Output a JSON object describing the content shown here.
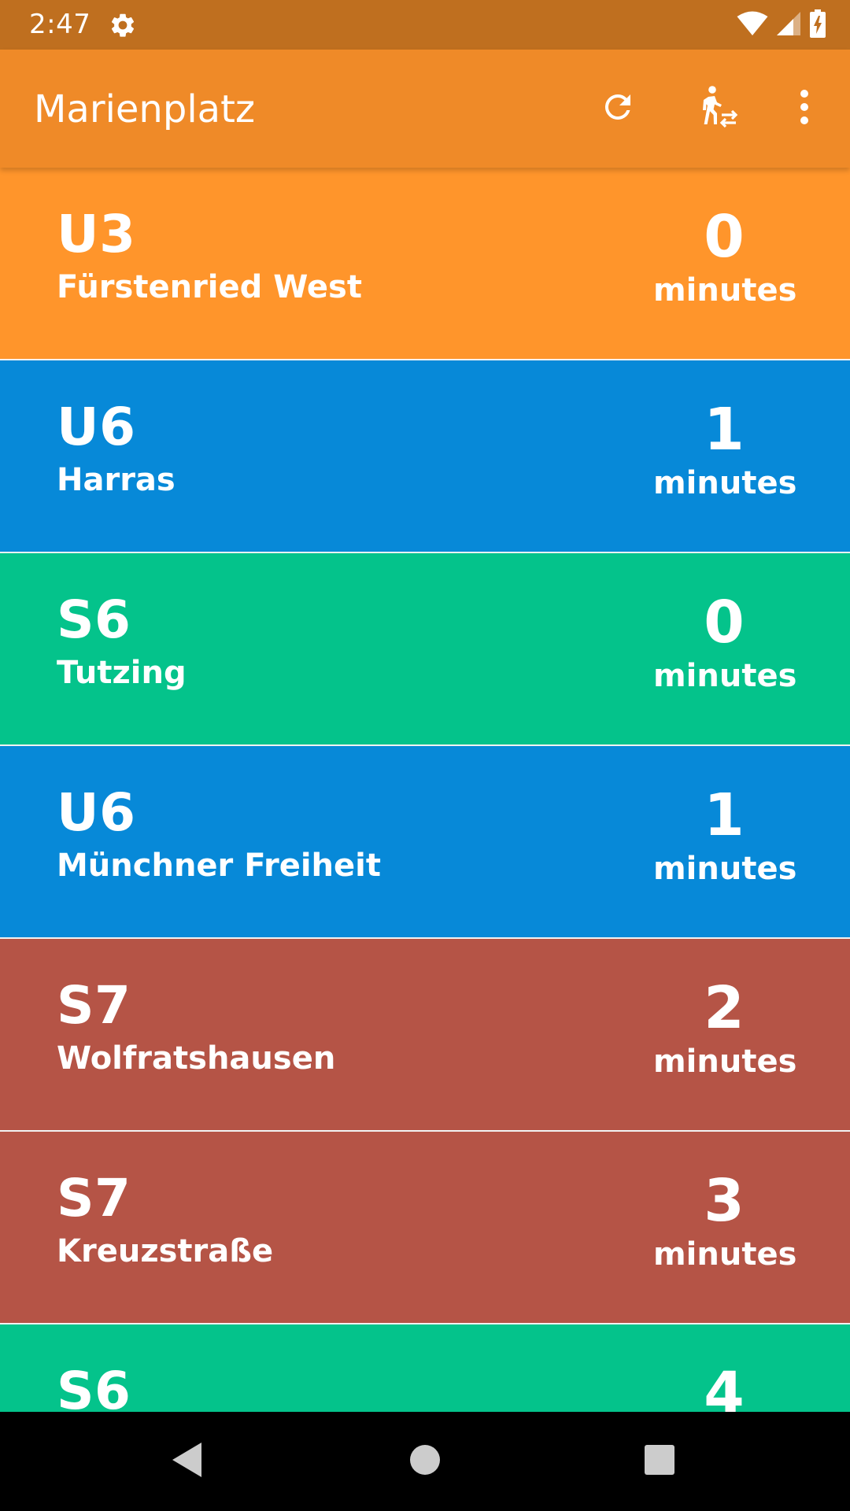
{
  "status_bar": {
    "time": "2:47",
    "icons": [
      "gear-icon",
      "wifi-icon",
      "signal-icon",
      "battery-charging-icon"
    ]
  },
  "app_bar": {
    "title": "Marienplatz",
    "actions": [
      "refresh-icon",
      "walk-transfer-icon",
      "more-vert-icon"
    ]
  },
  "colors": {
    "status_bar": "#BF6F1F",
    "app_bar": "#EF8A28",
    "U3": "#FF952B",
    "U6": "#0789D8",
    "S6": "#04C38B",
    "S7": "#B55446"
  },
  "departures": [
    {
      "line": "U3",
      "destination": "Fürstenried West",
      "minutes": "0",
      "unit": "minutes",
      "color": "#FF952B"
    },
    {
      "line": "U6",
      "destination": "Harras",
      "minutes": "1",
      "unit": "minutes",
      "color": "#0789D8"
    },
    {
      "line": "S6",
      "destination": "Tutzing",
      "minutes": "0",
      "unit": "minutes",
      "color": "#04C38B"
    },
    {
      "line": "U6",
      "destination": "Münchner Freiheit",
      "minutes": "1",
      "unit": "minutes",
      "color": "#0789D8"
    },
    {
      "line": "S7",
      "destination": "Wolfratshausen",
      "minutes": "2",
      "unit": "minutes",
      "color": "#B55446"
    },
    {
      "line": "S7",
      "destination": "Kreuzstraße",
      "minutes": "3",
      "unit": "minutes",
      "color": "#B55446"
    },
    {
      "line": "S6",
      "destination": "",
      "minutes": "4",
      "unit": "",
      "color": "#04C38B"
    }
  ],
  "nav_bar": {
    "icons": [
      "back-icon",
      "home-icon",
      "recents-icon"
    ]
  }
}
